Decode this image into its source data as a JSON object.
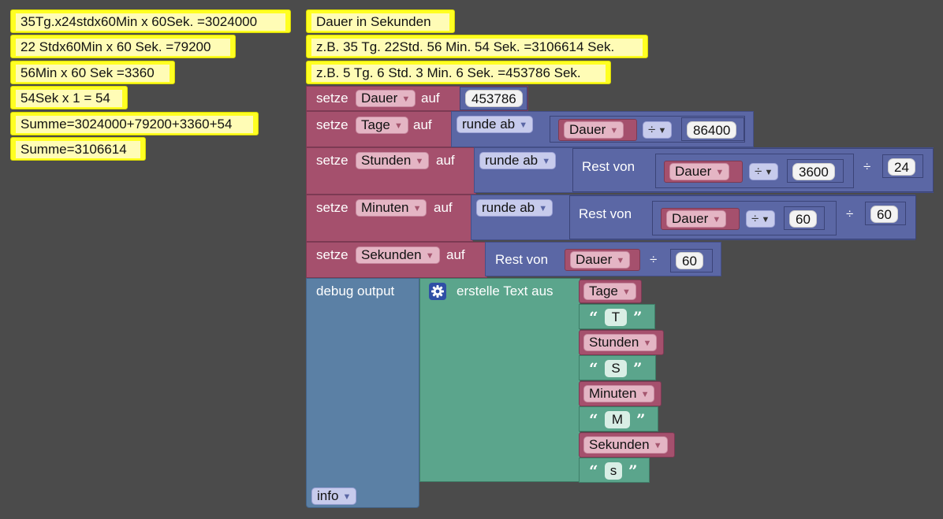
{
  "left_comments": [
    "35Tg.x24stdx60Min x 60Sek. =3024000",
    "22 Stdx60Min x 60 Sek. =79200",
    "56Min x 60 Sek =3360",
    "54Sek x 1 = 54",
    "Summe=3024000+79200+3360+54",
    "Summe=3106614"
  ],
  "main_comments": [
    "Dauer in Sekunden",
    "z.B. 35 Tg. 22Std. 56 Min. 54 Sek. =3106614 Sek.",
    "z.B. 5 Tg. 6 Std. 3 Min. 6 Sek. =453786 Sek."
  ],
  "keywords": {
    "setze": "setze",
    "auf": "auf",
    "runde_ab": "runde ab",
    "rest_von": "Rest von",
    "divide": "÷",
    "debug_output": "debug output",
    "erstelle_text": "erstelle Text aus",
    "info": "info",
    "open_quote": "“",
    "close_quote": "”"
  },
  "variables": {
    "dauer": "Dauer",
    "tage": "Tage",
    "stunden": "Stunden",
    "minuten": "Minuten",
    "sekunden": "Sekunden"
  },
  "numbers": {
    "dauer_value": "453786",
    "day_seconds": "86400",
    "hour_seconds": "3600",
    "hours_per_day": "24",
    "sixty": "60"
  },
  "text_items": [
    "T",
    "S",
    "M",
    "s"
  ],
  "colors": {
    "background": "#4b4b4b",
    "comment": "#ffff22",
    "variable_block": "#a5506d",
    "math_block": "#5b67a5",
    "text_block": "#5ba58c",
    "debug_block": "#5b80a5"
  },
  "icons": {
    "mutator": "gear-icon"
  }
}
